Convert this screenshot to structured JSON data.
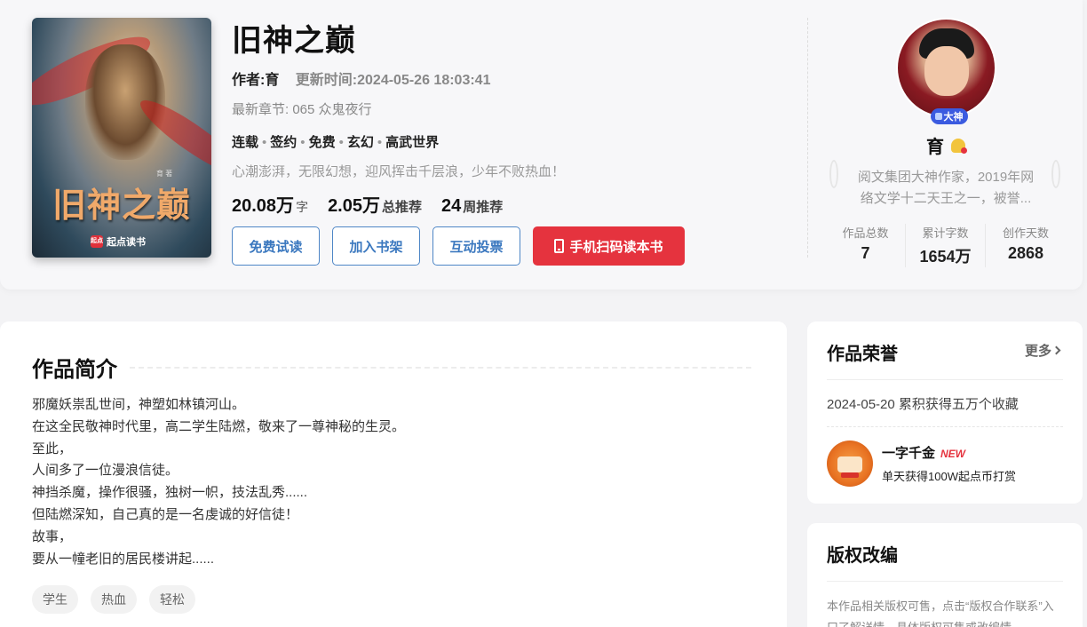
{
  "book": {
    "title": "旧神之巅",
    "cover_title": "旧神之巅",
    "cover_author": "育 著",
    "cover_brand_mark": "起点",
    "cover_brand": "起点读书",
    "author_line": "作者:育",
    "update_time": "更新时间:2024-05-26 18:03:41",
    "latest_chapter": "最新章节: 065 众鬼夜行",
    "tags": [
      "连载",
      "签约",
      "免费",
      "玄幻",
      "高武世界"
    ],
    "slogan": "心潮澎湃，无限幻想，迎风挥击千层浪，少年不败热血！",
    "stats": [
      {
        "num": "20.08万",
        "unit": "字"
      },
      {
        "num": "2.05万",
        "unit": "总推荐"
      },
      {
        "num": "24",
        "unit": "周推荐"
      }
    ]
  },
  "buttons": {
    "trial": "免费试读",
    "shelf": "加入书架",
    "vote": "互动投票",
    "scan": "手机扫码读本书"
  },
  "author": {
    "badge": "大神",
    "name": "育",
    "desc_line1": "阅文集团大神作家，2019年网",
    "desc_line2": "络文学十二天王之一，被誉...",
    "stats": [
      {
        "label": "作品总数",
        "value": "7"
      },
      {
        "label": "累计字数",
        "value": "1654万"
      },
      {
        "label": "创作天数",
        "value": "2868"
      }
    ]
  },
  "intro": {
    "title": "作品简介",
    "lines": [
      "邪魔妖祟乱世间，神塑如林镇河山。",
      "在这全民敬神时代里，高二学生陆燃，敬来了一尊神秘的生灵。",
      "至此，",
      "人间多了一位漫浪信徒。",
      "神挡杀魔，操作很骚，独树一帜，技法乱秀......",
      "但陆燃深知，自己真的是一名虔诚的好信徒！",
      "故事，",
      "要从一幢老旧的居民楼讲起......"
    ],
    "chips": [
      "学生",
      "热血",
      "轻松"
    ]
  },
  "honor": {
    "title": "作品荣誉",
    "more": "更多",
    "item": "2024-05-20 累积获得五万个收藏",
    "award_name": "一字千金",
    "award_new": "NEW",
    "award_desc": "单天获得100W起点币打赏"
  },
  "copyright": {
    "title": "版权改编",
    "text": "本作品相关版权可售，点击“版权合作联系”入口了解详情，具体版权可售或改编情"
  },
  "colors": {
    "accent_red": "#e5333e",
    "accent_blue": "#3b78bf",
    "badge_blue": "#3b5be0"
  }
}
